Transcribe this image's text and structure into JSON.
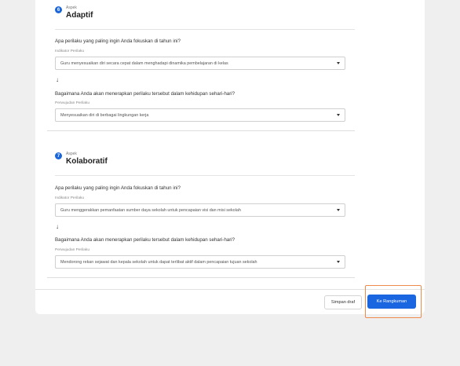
{
  "sections": [
    {
      "number": "6",
      "aspek_label": "Aspek",
      "title": "Adaptif",
      "question1": "Apa perilaku yang paling ingin Anda fokuskan di tahun ini?",
      "field1_label": "Indikator Perilaku",
      "field1_value": "Guru menyesuaikan diri secara cepat dalam menghadapi dinamika pembelajaran di kelas",
      "question2": "Bagaimana Anda akan menerapkan perilaku tersebut dalam kehidupan sehari-hari?",
      "field2_label": "Perwujudan Perilaku",
      "field2_value": "Menyesuaikan diri di berbagai lingkungan kerja"
    },
    {
      "number": "7",
      "aspek_label": "Aspek",
      "title": "Kolaboratif",
      "question1": "Apa perilaku yang paling ingin Anda fokuskan di tahun ini?",
      "field1_label": "Indikator Perilaku",
      "field1_value": "Guru menggerakkan pemanfaatan sumber daya sekolah untuk pencapaian visi dan misi sekolah",
      "question2": "Bagaimana Anda akan menerapkan perilaku tersebut dalam kehidupan sehari-hari?",
      "field2_label": "Perwujudan Perilaku",
      "field2_value": "Mendorong rekan sejawat dan kepala sekolah untuk dapat terlibat aktif dalam pencapaian tujuan sekolah"
    }
  ],
  "icons": {
    "arrow": "arrow-down-icon",
    "caret": "chevron-down-icon"
  },
  "footer": {
    "draft_label": "Simpan draf",
    "next_label": "Ke Rangkuman"
  },
  "colors": {
    "accent": "#1a66e0",
    "highlight": "#f08a4b"
  }
}
